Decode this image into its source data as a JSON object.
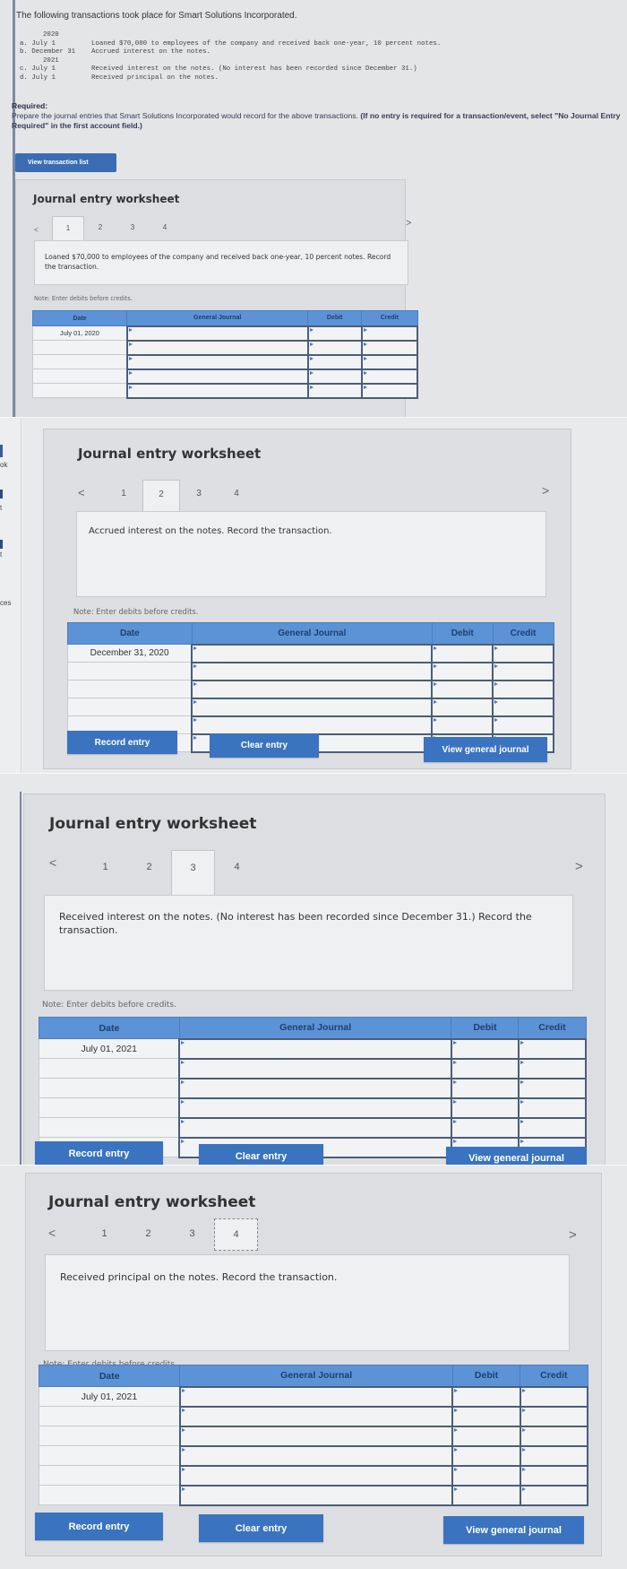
{
  "problem": {
    "intro": "The following transactions took place for Smart Solutions Incorporated.",
    "transactions": [
      {
        "year": "2020"
      },
      {
        "label": "a. July 1",
        "text": "Loaned $70,000 to employees of the company and received back one-year, 10 percent notes."
      },
      {
        "label": "b. December 31",
        "text": "Accrued interest on the notes."
      },
      {
        "year": "2021"
      },
      {
        "label": "c. July 1",
        "text": "Received interest on the notes. (No interest has been recorded since December 31.)"
      },
      {
        "label": "d. July 1",
        "text": "Received principal on the notes."
      }
    ],
    "required_label": "Required:",
    "required_text": "Prepare the journal entries that Smart Solutions Incorporated would record for the above transactions.",
    "required_bold": "(If no entry is required for a transaction/event, select \"No Journal Entry Required\" in the first account field.)",
    "view_transaction_list": "View transaction list"
  },
  "sidebar_fragments": [
    "ok",
    "t",
    "t",
    "ces"
  ],
  "worksheets": [
    {
      "title": "Journal entry worksheet",
      "tabs": [
        "1",
        "2",
        "3",
        "4"
      ],
      "active_tab": 1,
      "description": "Loaned $70,000 to employees of the company and received back one-year, 10 percent notes. Record the transaction.",
      "note": "Note: Enter debits before credits.",
      "columns": [
        "Date",
        "General Journal",
        "Debit",
        "Credit"
      ],
      "date": "July 01, 2020",
      "rows": 5
    },
    {
      "title": "Journal entry worksheet",
      "tabs": [
        "1",
        "2",
        "3",
        "4"
      ],
      "active_tab": 2,
      "description": "Accrued interest on the notes. Record the transaction.",
      "note": "Note: Enter debits before credits.",
      "columns": [
        "Date",
        "General Journal",
        "Debit",
        "Credit"
      ],
      "date": "December 31, 2020",
      "rows": 6,
      "buttons": {
        "record": "Record entry",
        "clear": "Clear entry",
        "view": "View general journal"
      }
    },
    {
      "title": "Journal entry worksheet",
      "tabs": [
        "1",
        "2",
        "3",
        "4"
      ],
      "active_tab": 3,
      "description": "Received interest on the notes. (No interest has been recorded since December 31.) Record the transaction.",
      "note": "Note: Enter debits before credits.",
      "columns": [
        "Date",
        "General Journal",
        "Debit",
        "Credit"
      ],
      "date": "July 01, 2021",
      "rows": 6,
      "buttons": {
        "record": "Record entry",
        "clear": "Clear entry",
        "view": "View general journal"
      }
    },
    {
      "title": "Journal entry worksheet",
      "tabs": [
        "1",
        "2",
        "3",
        "4"
      ],
      "active_tab": 4,
      "description": "Received principal on the notes. Record the transaction.",
      "note": "Note: Enter debits before credits.",
      "columns": [
        "Date",
        "General Journal",
        "Debit",
        "Credit"
      ],
      "date": "July 01, 2021",
      "rows": 6,
      "buttons": {
        "record": "Record entry",
        "clear": "Clear entry",
        "view": "View general journal"
      }
    }
  ],
  "icons": {
    "prev": "chevron-left-icon",
    "next": "chevron-right-icon",
    "prev_glyph": "<",
    "next_glyph": ">"
  },
  "colors": {
    "accent": "#3a73c0",
    "table_header": "#5b93d6",
    "input_border": "#4d5d78"
  }
}
